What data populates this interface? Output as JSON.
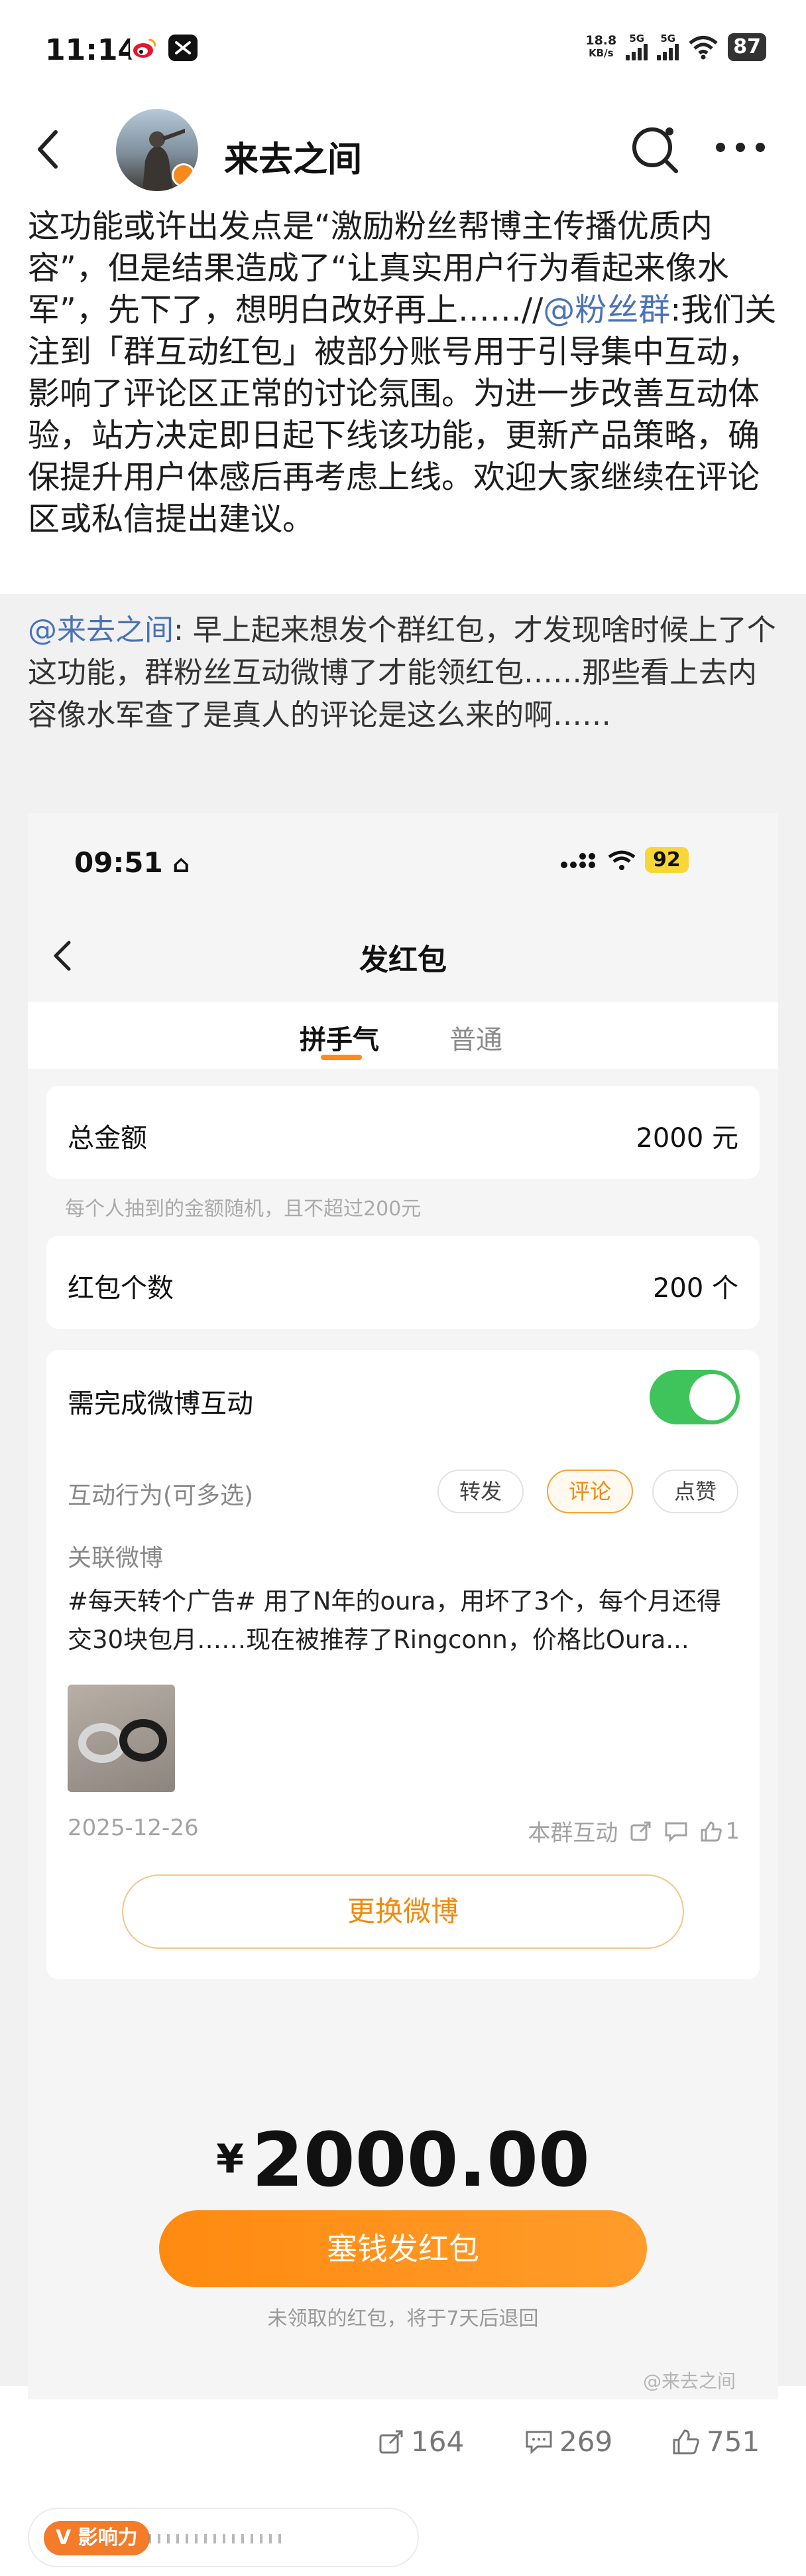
{
  "status_bar": {
    "time": "11:14",
    "net_speed_value": "18.8",
    "net_speed_unit": "KB/s",
    "signal1": "5G",
    "signal2": "5G",
    "battery": "87"
  },
  "header": {
    "username": "来去之间"
  },
  "post": {
    "body_prefix": "这功能或许出发点是“激励粉丝帮博主传播优质内容”，但是结果造成了“让真实用户行为看起来像水军”，先下了，想明白改好再上……//",
    "mention_group": "@粉丝群",
    "body_suffix": ":我们关注到「群互动红包」被部分账号用于引导集中互动，影响了评论区正常的讨论氛围。为进一步改善互动体验，站方决定即日起下线该功能，更新产品策略，确保提升用户体感后再考虑上线。欢迎大家继续在评论区或私信提出建议。"
  },
  "quote": {
    "mention_user": "@来去之间",
    "text": ": 早上起来想发个群红包，才发现啥时候上了个这功能，群粉丝互动微博了才能领红包……那些看上去内容像水军查了是真人的评论是这么来的啊……"
  },
  "embedded": {
    "time": "09:51",
    "battery": "92",
    "page_title": "发红包",
    "tabs": [
      "拼手气",
      "普通"
    ],
    "total_label": "总金额",
    "total_value": "2000 元",
    "total_hint": "每个人抽到的金额随机，且不超过200元",
    "count_label": "红包个数",
    "count_value": "200 个",
    "interaction_label": "需完成微博互动",
    "toggle_on": true,
    "behaviors_label": "互动行为(可多选)",
    "behaviors": [
      "转发",
      "评论",
      "点赞"
    ],
    "selected_behavior": "评论",
    "linked_label": "关联微博",
    "linked_text": "#每天转个广告# 用了N年的oura，用坏了3个，每个月还得交30块包月……现在被推荐了Ringconn，价格比Oura...",
    "linked_date": "2025-12-26",
    "linked_scope": "本群互动",
    "linked_likes": "1",
    "swap_button": "更换微博",
    "currency": "¥",
    "amount": "2000.00",
    "pay_button": "塞钱发红包",
    "refund_note": "未领取的红包，将于7天后退回",
    "watermark": "@来去之间"
  },
  "actions": {
    "reposts": "164",
    "comments": "269",
    "likes": "751"
  },
  "bottom": {
    "influence_label": "影响力"
  },
  "colors": {
    "link": "#4a73b8",
    "accent_orange": "#ff8a10",
    "toggle_green": "#3ec45a"
  }
}
